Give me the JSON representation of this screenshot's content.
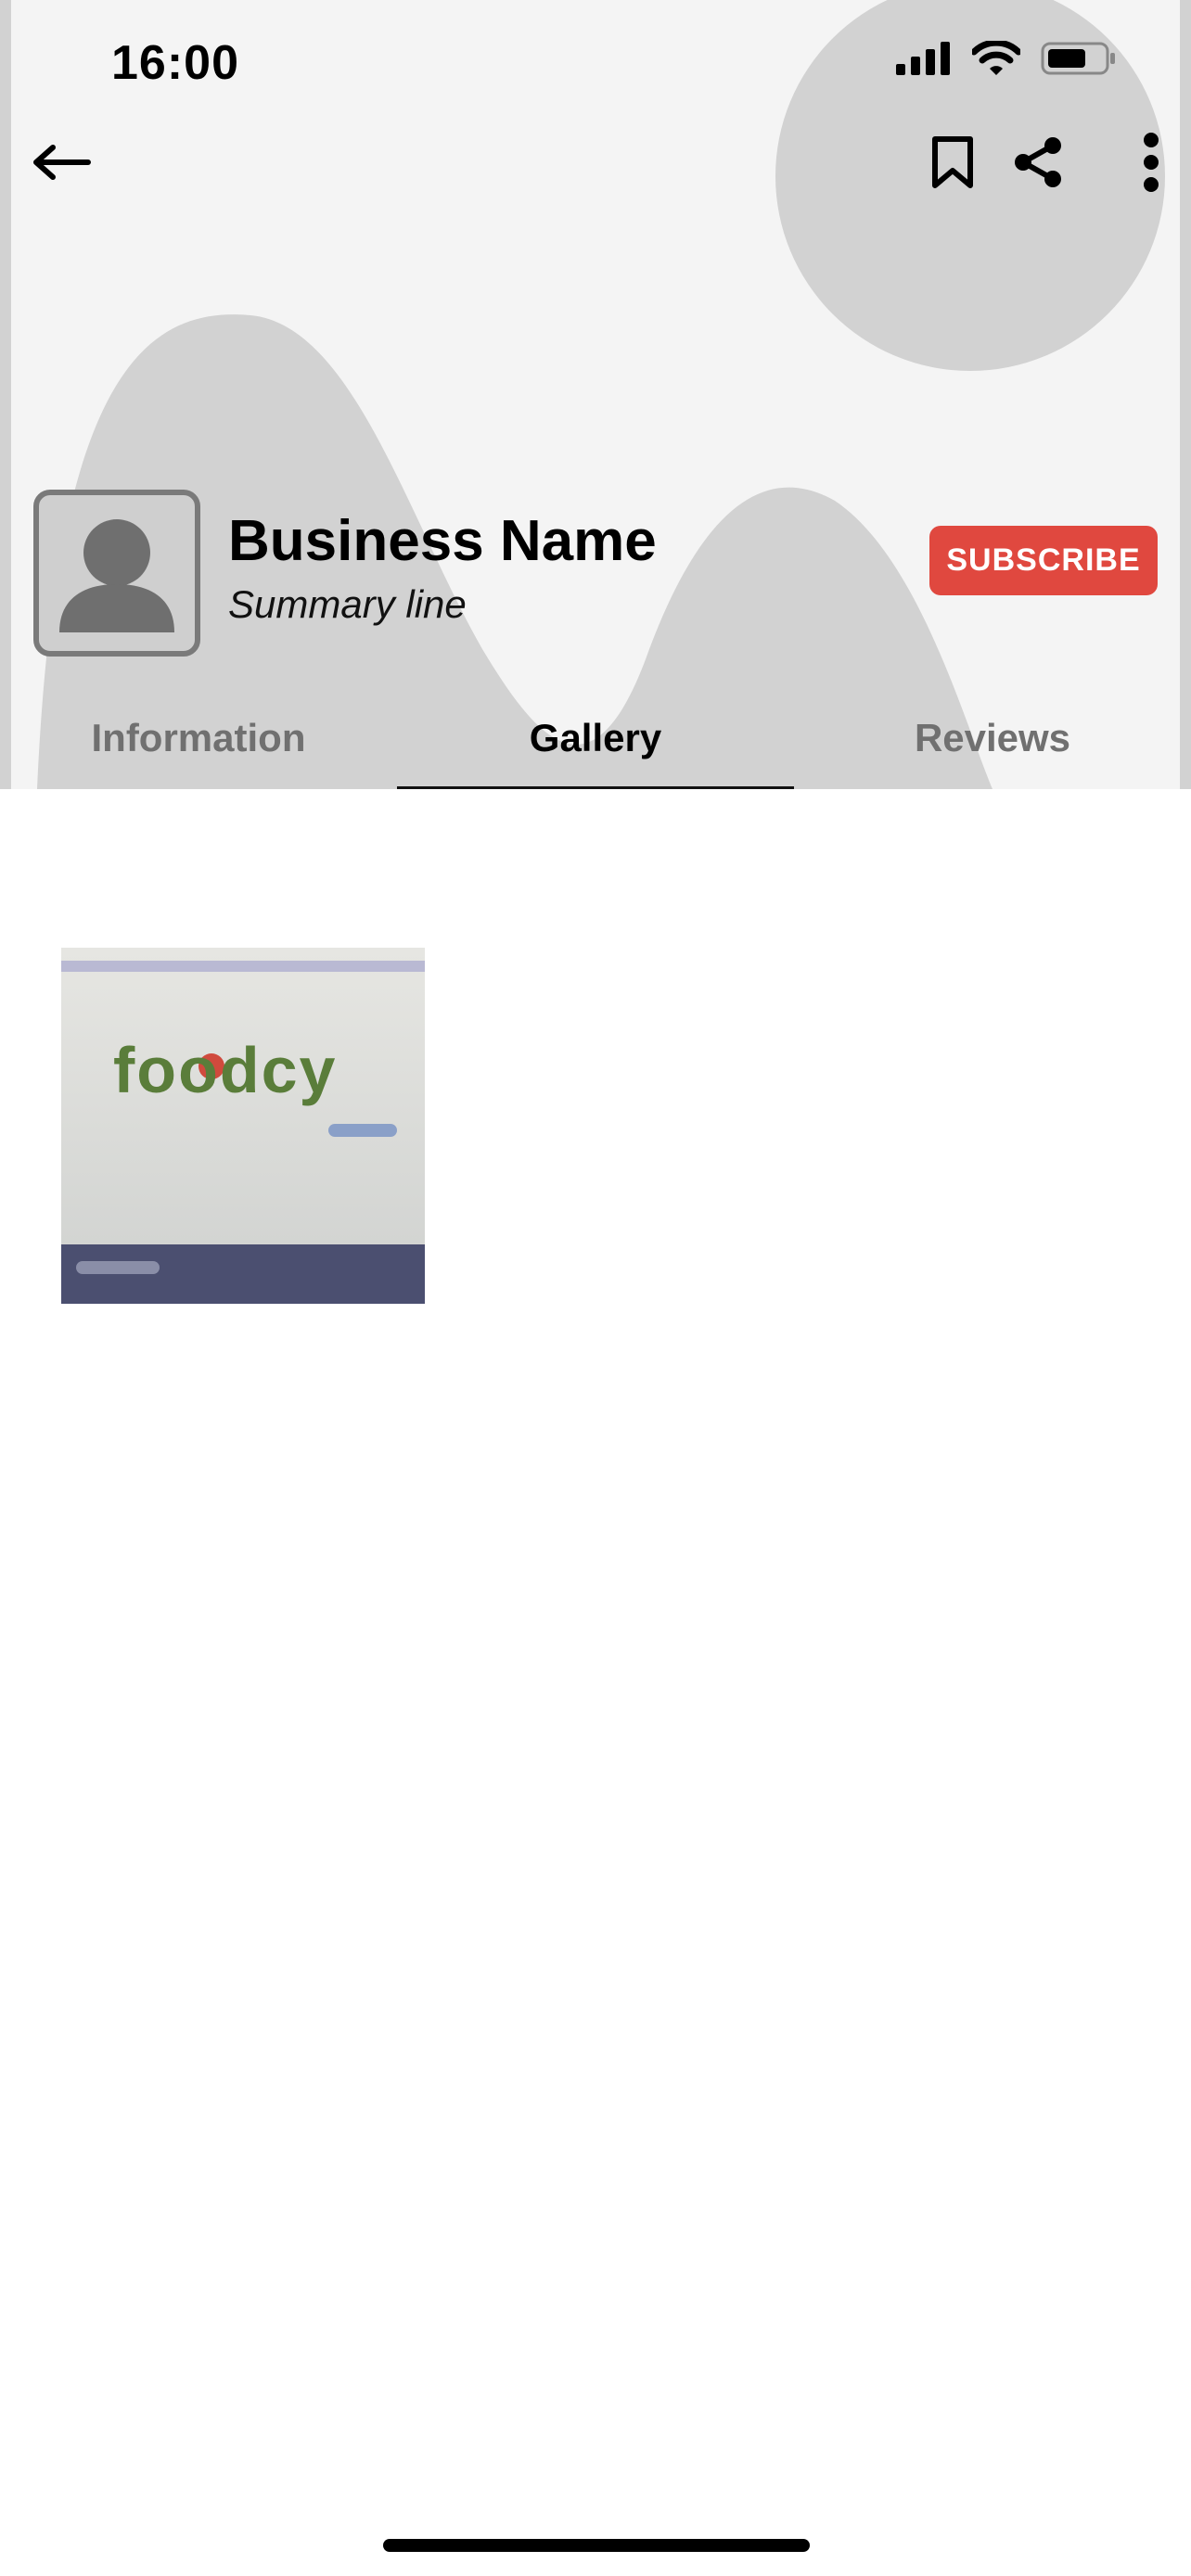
{
  "status_bar": {
    "time": "16:00",
    "icons": [
      "signal-icon",
      "wifi-icon",
      "battery-icon"
    ]
  },
  "toolbar": {
    "back_icon": "arrow-left-icon",
    "bookmark_icon": "bookmark-icon",
    "share_icon": "share-icon",
    "more_icon": "more-vertical-icon"
  },
  "business": {
    "name": "Business Name",
    "summary": "Summary line",
    "subscribe_label": "SUBSCRIBE",
    "avatar_icon": "user-placeholder-icon"
  },
  "tabs": [
    {
      "label": "Information",
      "active": false
    },
    {
      "label": "Gallery",
      "active": true
    },
    {
      "label": "Reviews",
      "active": false
    }
  ],
  "gallery": {
    "items": [
      {
        "logo_text": "foodcy"
      }
    ]
  },
  "colors": {
    "accent": "#e0483f",
    "header_bg": "#f4f4f4",
    "header_shape": "#d2d2d2",
    "tab_inactive": "#707070",
    "tab_active": "#000000"
  }
}
